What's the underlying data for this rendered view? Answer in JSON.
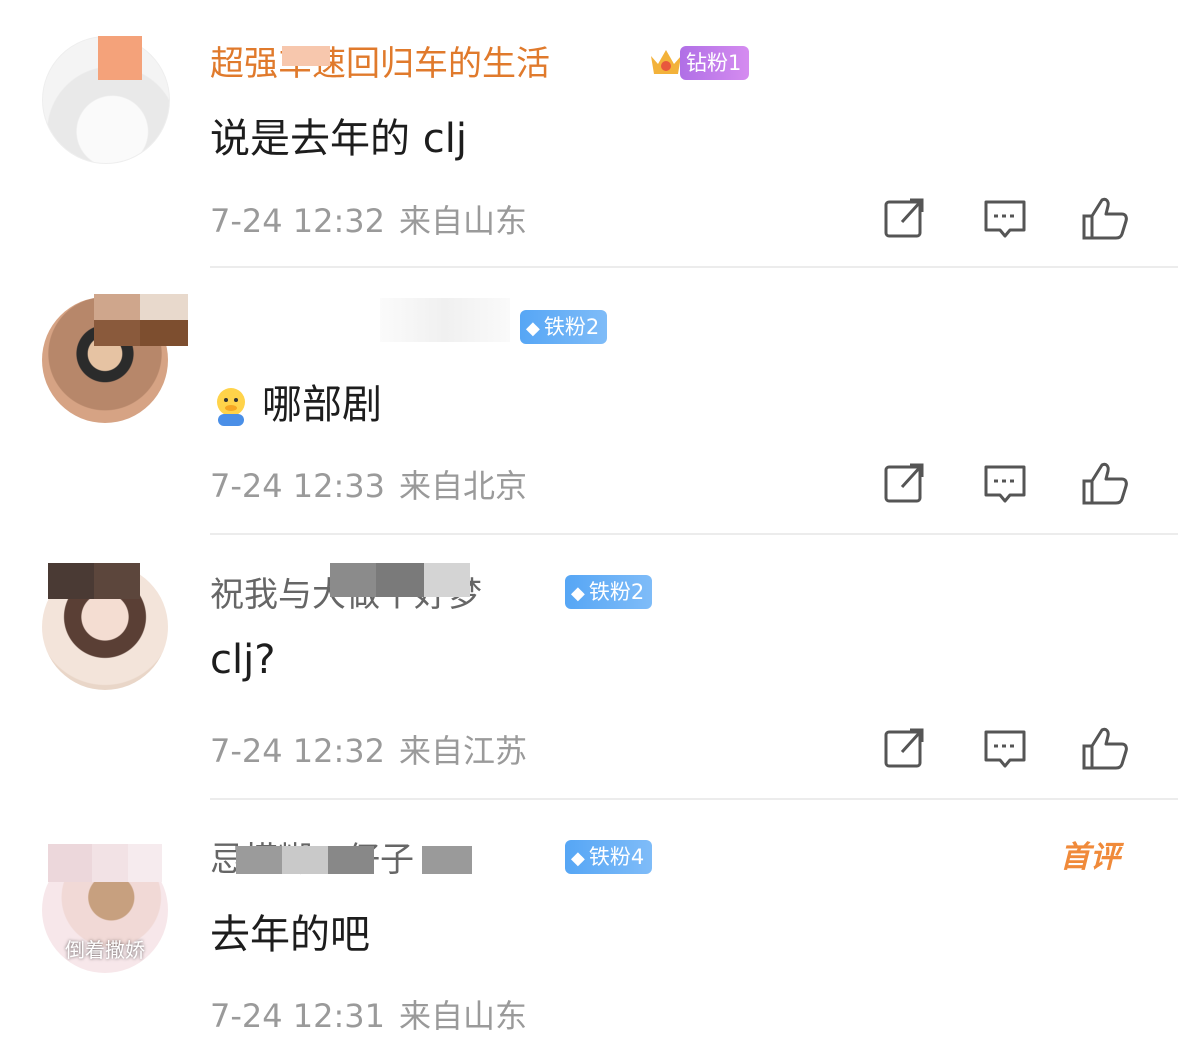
{
  "colors": {
    "username_orange": "#e07a2c",
    "diamond_badge": "#c07ee9",
    "iron_badge": "#66aef6",
    "meta_grey": "#9a9a9a",
    "first_comment_orange": "#f08a3a"
  },
  "comments": [
    {
      "username": "超强车速回归车的生活",
      "badge": {
        "icon": "crown-icon",
        "label": "钻粉1",
        "type": "diamond"
      },
      "text": "说是去年的 clj",
      "time": "7-24 12:32",
      "location": "来自山东",
      "actions": [
        "share-icon",
        "reply-icon",
        "like-icon"
      ]
    },
    {
      "username": "",
      "badge": {
        "icon": "diamond-icon",
        "label": "铁粉2",
        "type": "iron"
      },
      "emoji": "face-emoji",
      "text": "哪部剧",
      "time": "7-24 12:33",
      "location": "来自北京",
      "actions": [
        "share-icon",
        "reply-icon",
        "like-icon"
      ]
    },
    {
      "username": "祝我与大做个好梦",
      "badge": {
        "icon": "diamond-icon",
        "label": "铁粉2",
        "type": "iron"
      },
      "text": "clj?",
      "time": "7-24 12:32",
      "location": "来自江苏",
      "actions": [
        "share-icon",
        "reply-icon",
        "like-icon"
      ]
    },
    {
      "username": "忌模糊口仔子",
      "badge": {
        "icon": "diamond-icon",
        "label": "铁粉4",
        "type": "iron"
      },
      "avatar_caption": "倒着撒娇",
      "first_comment_tag": "首评",
      "text": "去年的吧",
      "time": "7-24 12:31",
      "location": "来自山东",
      "actions": []
    }
  ]
}
